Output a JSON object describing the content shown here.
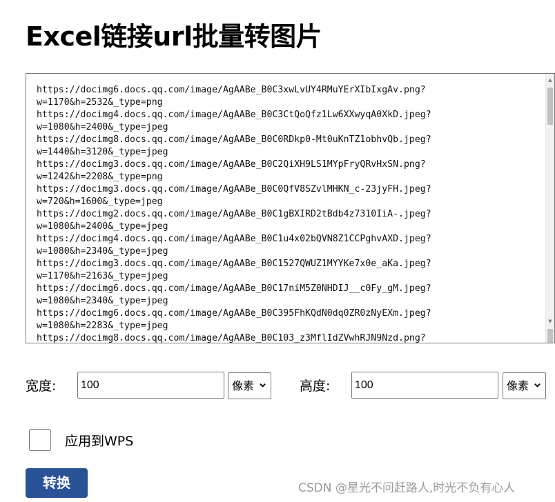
{
  "page": {
    "title": "Excel链接url批量转图片"
  },
  "url_textarea": {
    "lines": [
      "https://docimg6.docs.qq.com/image/AgAABe_B0C3xwLvUY4RMuYErXIbIxgAv.png?",
      "w=1170&h=2532&_type=png",
      "https://docimg4.docs.qq.com/image/AgAABe_B0C3CtQoQfz1Lw6XXwyqA0XkD.jpeg?",
      "w=1080&h=2400&_type=jpeg",
      "https://docimg8.docs.qq.com/image/AgAABe_B0C0RDkp0-Mt0uKnTZ1obhvQb.jpeg?",
      "w=1440&h=3120&_type=jpeg",
      "https://docimg3.docs.qq.com/image/AgAABe_B0C2QiXH9LS1MYpFryQRvHxSN.png?",
      "w=1242&h=2208&_type=png",
      "https://docimg3.docs.qq.com/image/AgAABe_B0C0QfV8SZvlMHKN_c-23jyFH.jpeg?",
      "w=720&h=1600&_type=jpeg",
      "https://docimg2.docs.qq.com/image/AgAABe_B0C1gBXIRD2tBdb4z7310IiA-.jpeg?",
      "w=1080&h=2400&_type=jpeg",
      "https://docimg4.docs.qq.com/image/AgAABe_B0C1u4x02bQVN8Z1CCPghvAXD.jpeg?",
      "w=1080&h=2340&_type=jpeg",
      "https://docimg3.docs.qq.com/image/AgAABe_B0C1527QWUZ1MYYKe7x0e_aKa.jpeg?",
      "w=1170&h=2163&_type=jpeg",
      "https://docimg6.docs.qq.com/image/AgAABe_B0C17niM5Z0NHDIJ__c0Fy_gM.jpeg?",
      "w=1080&h=2340&_type=jpeg",
      "https://docimg6.docs.qq.com/image/AgAABe_B0C395FhKQdN0dq0ZR0zNyEXm.jpeg?",
      "w=1080&h=2283&_type=jpeg",
      "https://docimg8.docs.qq.com/image/AgAABe_B0C103_z3MflIdZVwhRJN9Nzd.png?"
    ]
  },
  "width_field": {
    "label": "宽度:",
    "value": "100",
    "unit": "像素"
  },
  "height_field": {
    "label": "高度:",
    "value": "100",
    "unit": "像素"
  },
  "wps_option": {
    "label": "应用到WPS"
  },
  "convert_button": {
    "label": "转换"
  },
  "watermark": {
    "text": "CSDN @星光不问赶路人,时光不负有心人"
  }
}
